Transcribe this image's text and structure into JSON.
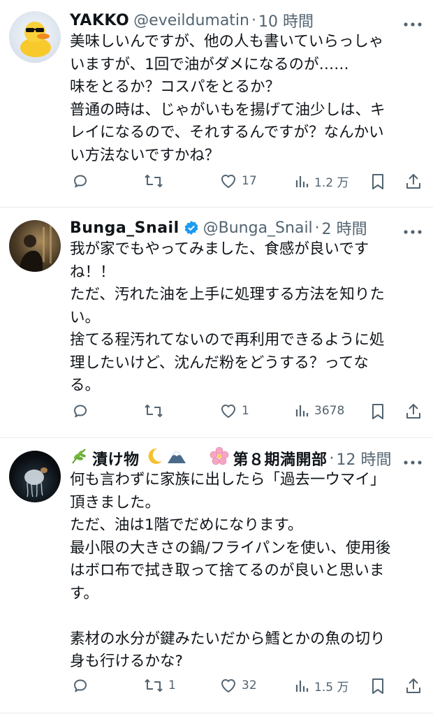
{
  "tweets": [
    {
      "name": "YAKKO",
      "handle": "@eveildumatin",
      "sep": "·",
      "time": "10 時間",
      "text": "美味しいんですが、他の人も書いていらっしゃ\nいますが、1回で油がダメになるのが……\n味をとるか？コスパをとるか？\n普通の時は、じゃがいもを揚げて油少しは、キ\nレイになるので、それするんですが？なんかい\nい方法ないですかね？",
      "reply_count": "",
      "retweet_count": "",
      "like_count": "17",
      "view_count": "1.2 万"
    },
    {
      "name": "Bunga_Snail",
      "handle": "@Bunga_Snail",
      "sep": "·",
      "time": "2 時間",
      "text": "我が家でもやってみました、食感が良いです\nね！！\nただ、汚れた油を上手に処理する方法を知りた\nい。\n捨てる程汚れてないので再利用できるように処\n理したいけど、沈んだ粉をどうする？ってな\nる。",
      "reply_count": "",
      "retweet_count": "",
      "like_count": "1",
      "view_count": "3678"
    },
    {
      "name_part1": "漬け物",
      "name_part2": "第８期満開部",
      "sep": "·",
      "time": "12 時間",
      "text": "何も言わずに家族に出したら「過去一ウマイ」\n頂きました。\nただ、油は1階でだめになります。\n最小限の大きさの鍋/フライパンを使い、使用後\nはボロ布で拭き取って捨てるのが良いと思いま\nす。\n\n素材の水分が鍵みたいだから鱈とかの魚の切り\n身も行けるかな?",
      "reply_count": "",
      "retweet_count": "1",
      "like_count": "32",
      "view_count": "1.5 万"
    }
  ],
  "colors": {
    "text": "#0f1419",
    "muted": "#536471",
    "verified": "#1d9bf0",
    "divider": "#e6e9ec"
  },
  "icons": [
    "reply-icon",
    "retweet-icon",
    "like-icon",
    "views-icon",
    "bookmark-icon",
    "share-icon",
    "more-icon",
    "verified-badge-icon"
  ]
}
